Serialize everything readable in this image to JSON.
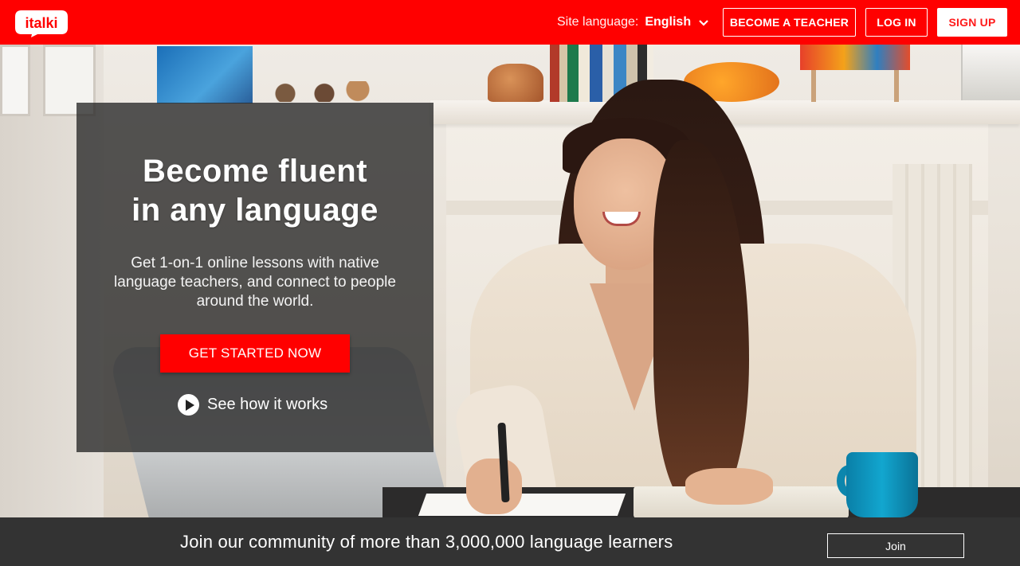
{
  "header": {
    "logo_text": "italki",
    "brand_color": "#ff0000",
    "site_language_label": "Site language:",
    "site_language_value": "English",
    "become_teacher": "BECOME A TEACHER",
    "log_in": "LOG IN",
    "sign_up": "SIGN UP"
  },
  "hero": {
    "title_line1": "Become fluent",
    "title_line2": "in any language",
    "subtitle": "Get 1-on-1 online lessons with native language teachers, and connect to people around the world.",
    "cta": "GET STARTED NOW",
    "how_it_works": "See how it works"
  },
  "joinbar": {
    "text": "Join our community of more than 3,000,000 language learners",
    "button": "Join"
  }
}
